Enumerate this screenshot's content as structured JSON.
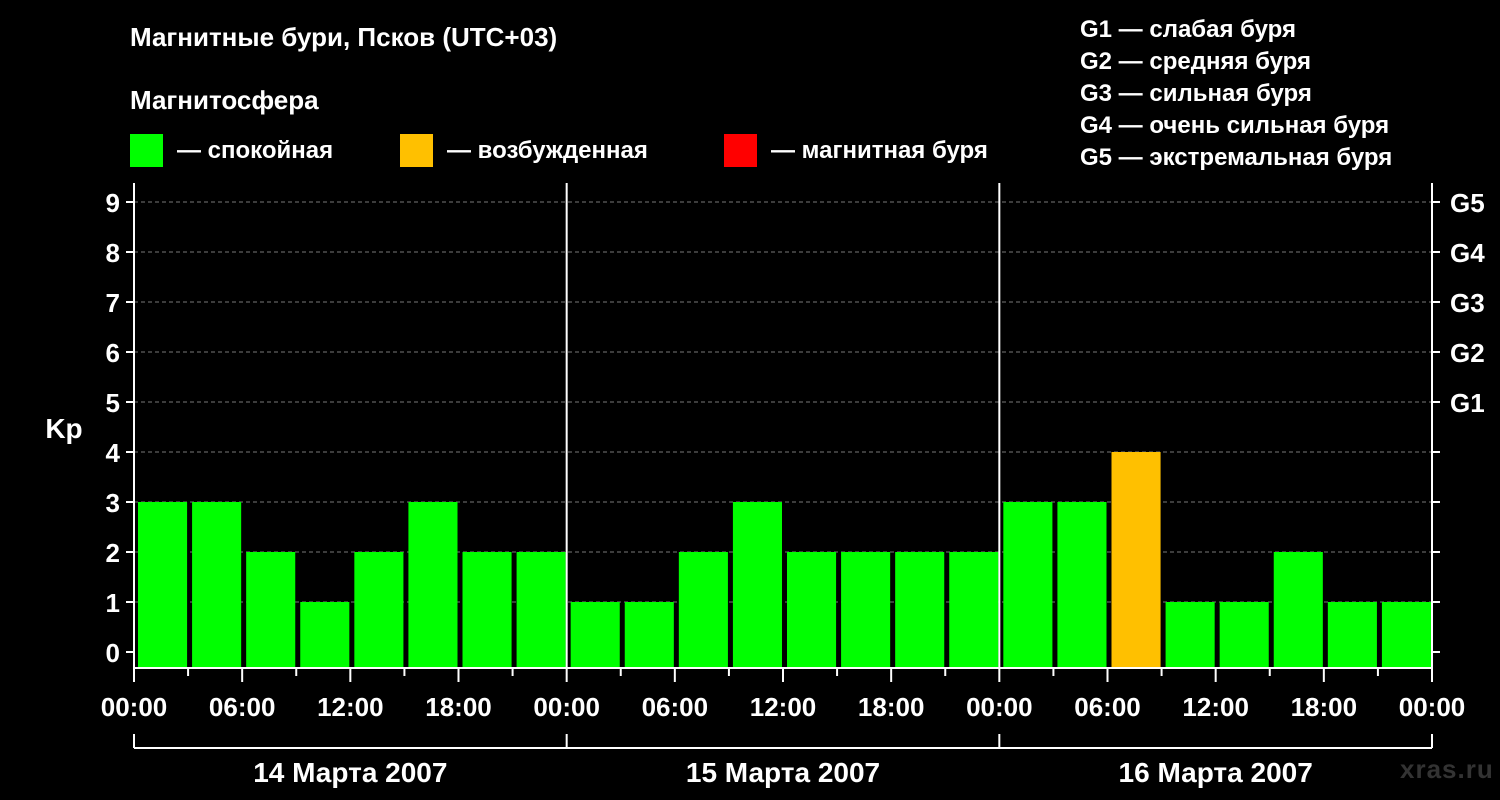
{
  "header": {
    "title": "Магнитные бури, Псков (UTC+03)",
    "subtitle": "Магнитосфера"
  },
  "legend": [
    {
      "label": "— спокойная",
      "color": "#00ff00"
    },
    {
      "label": "— возбужденная",
      "color": "#ffc000"
    },
    {
      "label": "— магнитная буря",
      "color": "#ff0000"
    }
  ],
  "g_scale": [
    "G1 — слабая буря",
    "G2 — средняя буря",
    "G3 — сильная буря",
    "G4 — очень сильная буря",
    "G5 — экстремальная буря"
  ],
  "watermark": "xras.ru",
  "colors": {
    "quiet": "#00ff00",
    "active": "#ffc000",
    "storm": "#ff0000",
    "background": "#000000"
  },
  "chart_data": {
    "type": "bar",
    "ylabel": "Kp",
    "ylim": [
      0,
      9
    ],
    "yticks": [
      "0",
      "1",
      "2",
      "3",
      "4",
      "5",
      "6",
      "7",
      "8",
      "9"
    ],
    "right_ticks": [
      {
        "value": 5,
        "label": "G1"
      },
      {
        "value": 6,
        "label": "G2"
      },
      {
        "value": 7,
        "label": "G3"
      },
      {
        "value": 8,
        "label": "G4"
      },
      {
        "value": 9,
        "label": "G5"
      }
    ],
    "grid": "dashed horizontal at integer Kp",
    "xticks": [
      "00:00",
      "06:00",
      "12:00",
      "18:00",
      "00:00",
      "06:00",
      "12:00",
      "18:00",
      "00:00",
      "06:00",
      "12:00",
      "18:00",
      "00:00"
    ],
    "days": [
      "14 Марта 2007",
      "15 Марта 2007",
      "16 Марта 2007"
    ],
    "interval_hours": 3,
    "values": [
      3,
      3,
      2,
      1,
      2,
      3,
      2,
      2,
      1,
      1,
      2,
      3,
      2,
      2,
      2,
      2,
      3,
      3,
      4,
      1,
      1,
      2,
      1,
      1
    ],
    "thresholds": {
      "active": 4,
      "storm": 5
    }
  }
}
